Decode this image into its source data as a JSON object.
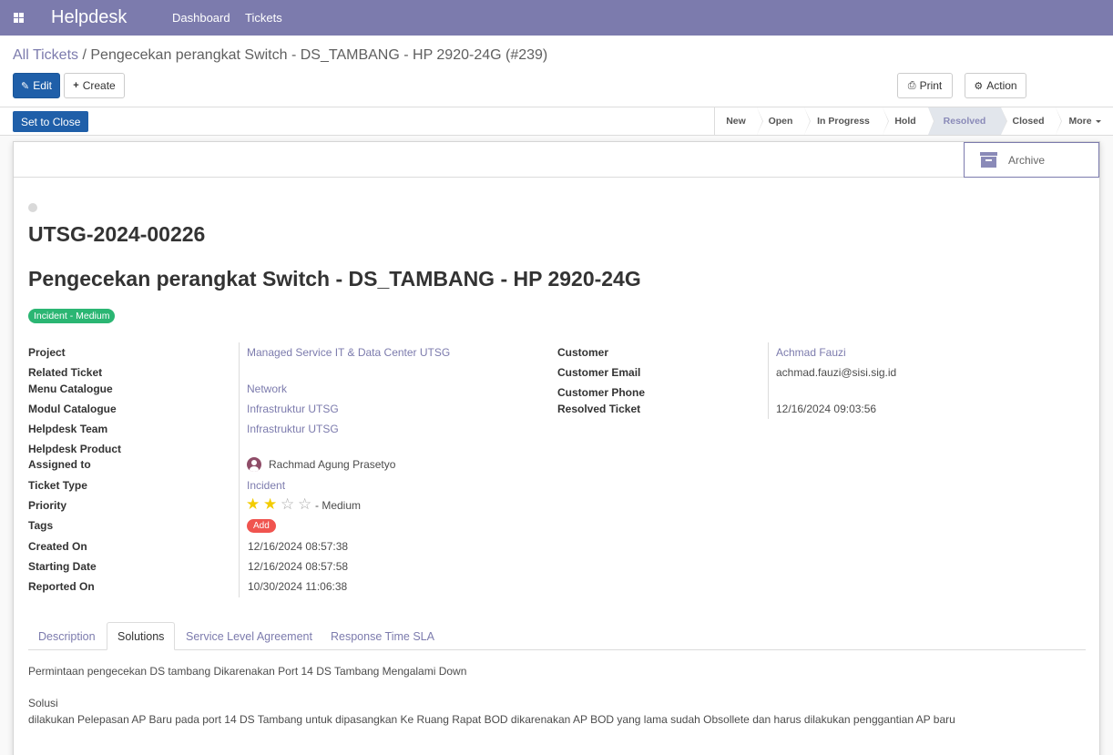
{
  "navbar": {
    "brand": "Helpdesk",
    "menu": [
      "Dashboard",
      "Tickets"
    ]
  },
  "breadcrumb": {
    "parent": "All Tickets",
    "separator": "/",
    "current": "Pengecekan perangkat Switch - DS_TAMBANG - HP 2920-24G (#239)"
  },
  "toolbar": {
    "edit": "Edit",
    "create": "Create",
    "print": "Print",
    "action": "Action"
  },
  "statusbar": {
    "close_button": "Set to Close",
    "stages": [
      "New",
      "Open",
      "In Progress",
      "Hold",
      "Resolved",
      "Closed",
      "More"
    ],
    "active_stage": "Resolved"
  },
  "button_box": {
    "archive": "Archive"
  },
  "ticket": {
    "number": "UTSG-2024-00226",
    "name": "Pengecekan perangkat Switch - DS_TAMBANG - HP 2920-24G",
    "badge": "Incident - Medium"
  },
  "fields_left": {
    "project_label": "Project",
    "project": "Managed Service IT & Data Center UTSG",
    "related_label": "Related Ticket",
    "menu_catalogue_label": "Menu Catalogue",
    "menu_catalogue": "Network",
    "modul_catalogue_label": "Modul Catalogue",
    "modul_catalogue": "Infrastruktur UTSG",
    "team_label": "Helpdesk Team",
    "team": "Infrastruktur UTSG",
    "product_label": "Helpdesk Product",
    "assigned_label": "Assigned to",
    "assigned": "Rachmad Agung Prasetyo",
    "ticket_type_label": "Ticket Type",
    "ticket_type": "Incident",
    "priority_label": "Priority",
    "priority_stars": 2,
    "priority_max": 4,
    "priority_text": "- Medium",
    "tags_label": "Tags",
    "tags_add": "Add",
    "created_label": "Created On",
    "created": "12/16/2024 08:57:38",
    "starting_label": "Starting Date",
    "starting": "12/16/2024 08:57:58",
    "reported_label": "Reported On",
    "reported": "10/30/2024 11:06:38"
  },
  "fields_right": {
    "customer_label": "Customer",
    "customer": "Achmad Fauzi",
    "email_label": "Customer Email",
    "email": "achmad.fauzi@sisi.sig.id",
    "phone_label": "Customer Phone",
    "resolved_label": "Resolved Ticket",
    "resolved": "12/16/2024 09:03:56"
  },
  "tabs": [
    "Description",
    "Solutions",
    "Service Level Agreement",
    "Response Time SLA"
  ],
  "active_tab": "Solutions",
  "solutions": {
    "line1": "Permintaan pengecekan DS tambang Dikarenakan Port 14 DS Tambang Mengalami Down",
    "line2": "Solusi",
    "line3": "dilakukan Pelepasan AP Baru pada port 14 DS Tambang untuk dipasangkan Ke Ruang Rapat BOD dikarenakan AP BOD yang lama sudah Obsollete dan harus dilakukan penggantian AP baru"
  },
  "colors": {
    "navbar": "#7c7bad",
    "primary": "#1f5fa9",
    "badge": "#2bb673",
    "tag_add": "#f0544f",
    "star": "#f3cc00"
  }
}
